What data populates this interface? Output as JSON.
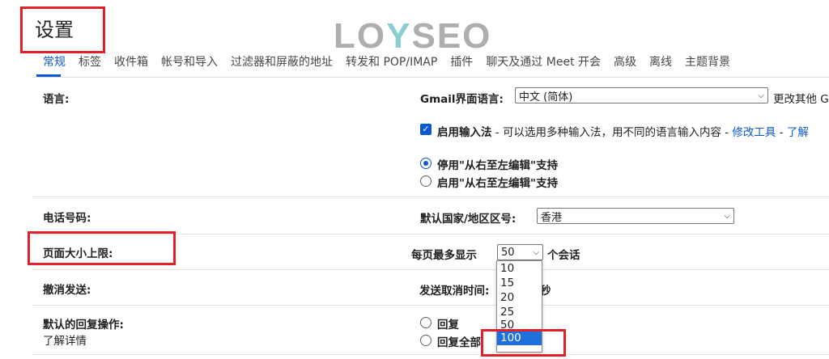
{
  "header": {
    "title": "设置"
  },
  "watermark": {
    "text_a": "LO",
    "text_b": "Y",
    "text_c": "SEO"
  },
  "tabs": [
    {
      "label": "常规"
    },
    {
      "label": "标签"
    },
    {
      "label": "收件箱"
    },
    {
      "label": "帐号和导入"
    },
    {
      "label": "过滤器和屏蔽的地址"
    },
    {
      "label": "转发和 POP/IMAP"
    },
    {
      "label": "插件"
    },
    {
      "label": "聊天及通过 Meet 开会"
    },
    {
      "label": "高级"
    },
    {
      "label": "离线"
    },
    {
      "label": "主题背景"
    }
  ],
  "language": {
    "label": "语言:",
    "ui_label": "Gmail界面语言:",
    "ui_value": "中文 (简体)",
    "change_other": "更改其他 G",
    "ime_bold": "启用输入法",
    "ime_desc": " - 可以选用多种输入法，用不同的语言输入内容 - ",
    "ime_edit": "修改工具",
    "ime_sep": " - ",
    "ime_learn": "了解",
    "rtl_off": "停用\"从右至左编辑\"支持",
    "rtl_on": "启用\"从右至左编辑\"支持"
  },
  "phone": {
    "label": "电话号码:",
    "country_label": "默认国家/地区区号:",
    "country_value": "香港"
  },
  "page_size": {
    "label": "页面大小上限:",
    "prefix": "每页最多显示",
    "value": "50",
    "suffix": "个会话",
    "options": [
      "10",
      "15",
      "20",
      "25",
      "50",
      "100"
    ],
    "selected": "100"
  },
  "undo": {
    "label": "撤消发送:",
    "delay_label": "发送取消时间:",
    "delay_unit": "秒"
  },
  "reply": {
    "label": "默认的回复操作:",
    "learn_more": "了解详情",
    "reply": "回复",
    "reply_all": "回复全部"
  },
  "colors": {
    "accent": "#0b57d0",
    "highlight": "#e0202a"
  }
}
